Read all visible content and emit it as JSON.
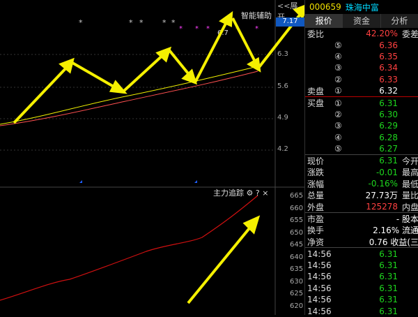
{
  "header": {
    "collapse_label": "<<展开",
    "assist_label": "智能辅助",
    "price_tag": "7.17",
    "code": "000659",
    "name": "珠海中富"
  },
  "tabs": [
    "报价",
    "资金",
    "分析"
  ],
  "price_axis": [
    "6.3",
    "5.6",
    "4.9",
    "4.2"
  ],
  "indicator": {
    "title": "主力追踪",
    "axis": [
      "665",
      "660",
      "655",
      "650",
      "645",
      "640",
      "635",
      "630",
      "625",
      "620"
    ]
  },
  "order_book": {
    "ratio_label": "委比",
    "ratio_value": "42.20%",
    "diff_label": "委差",
    "sell_label": "卖盘",
    "buy_label": "买盘",
    "sells": [
      {
        "n": "⑤",
        "p": "6.36"
      },
      {
        "n": "④",
        "p": "6.35"
      },
      {
        "n": "③",
        "p": "6.34"
      },
      {
        "n": "②",
        "p": "6.33"
      },
      {
        "n": "①",
        "p": "6.32"
      }
    ],
    "buys": [
      {
        "n": "①",
        "p": "6.31"
      },
      {
        "n": "②",
        "p": "6.30"
      },
      {
        "n": "③",
        "p": "6.29"
      },
      {
        "n": "④",
        "p": "6.28"
      },
      {
        "n": "⑤",
        "p": "6.27"
      }
    ]
  },
  "quote": [
    {
      "l": "现价",
      "v": "6.31",
      "c": "green",
      "r": "今开"
    },
    {
      "l": "涨跌",
      "v": "-0.01",
      "c": "green",
      "r": "最高"
    },
    {
      "l": "涨幅",
      "v": "-0.16%",
      "c": "green",
      "r": "最低"
    },
    {
      "l": "总量",
      "v": "27.73万",
      "c": "white",
      "r": "量比"
    },
    {
      "l": "外盘",
      "v": "125278",
      "c": "red",
      "r": "内盘"
    }
  ],
  "fund": [
    {
      "l": "市盈",
      "v": "- 股本",
      "c": "white"
    },
    {
      "l": "换手",
      "v": "2.16% 流通",
      "c": "white"
    },
    {
      "l": "净资",
      "v": "0.76 收益(三",
      "c": "white"
    }
  ],
  "ticks": [
    {
      "t": "14:56",
      "p": "6.31"
    },
    {
      "t": "14:56",
      "p": "6.31"
    },
    {
      "t": "14:56",
      "p": "6.31"
    },
    {
      "t": "14:56",
      "p": "6.31"
    },
    {
      "t": "14:56",
      "p": "6.31"
    },
    {
      "t": "14:56",
      "p": "6.31"
    }
  ],
  "annotation": "6.7",
  "colors": {
    "up": "#ff4040",
    "down": "#00c8ff",
    "ma1": "#f0f000",
    "ma2": "#ff5050",
    "arrow": "#f5f000"
  }
}
